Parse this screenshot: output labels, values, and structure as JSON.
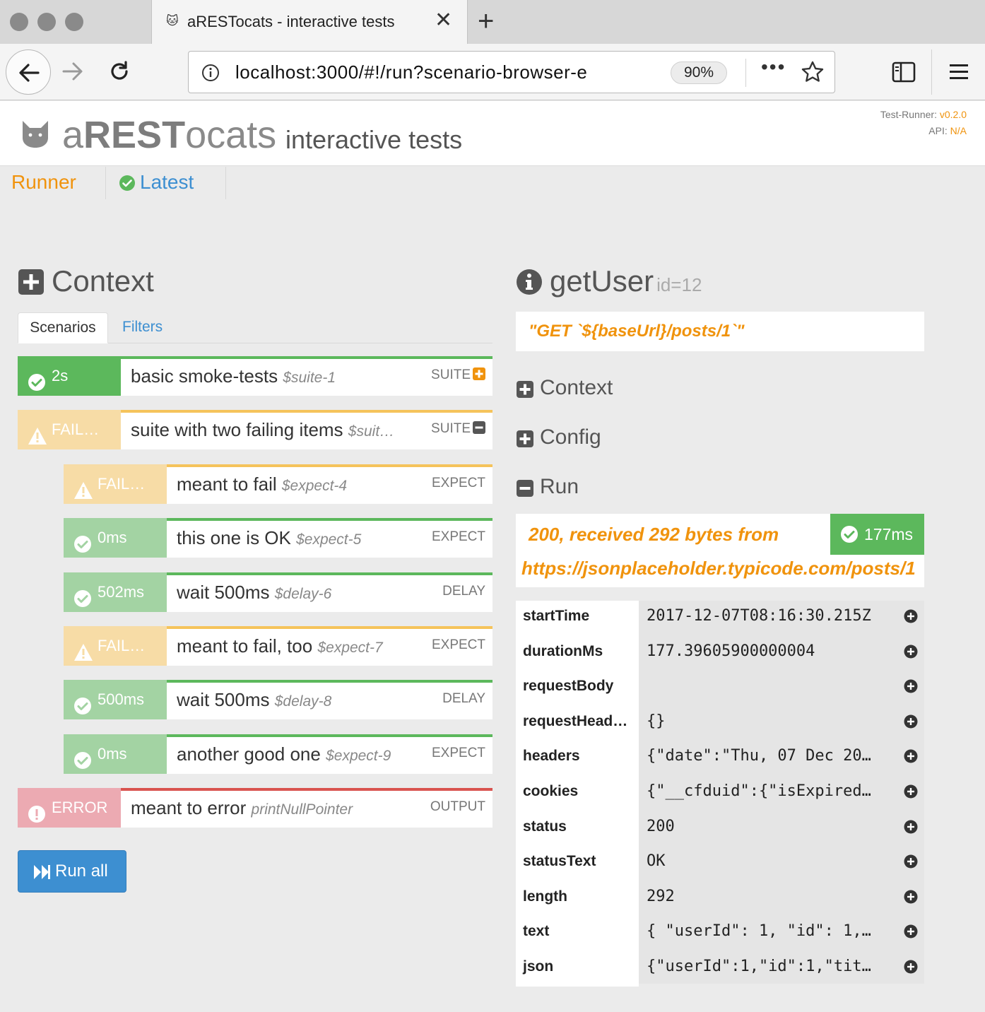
{
  "browser": {
    "tab_title": "aRESTocats - interactive tests",
    "tab_favicon": "🐱",
    "url": "localhost:3000/#!/run?scenario-browser-e",
    "zoom": "90%"
  },
  "header": {
    "brand_regular_1": "a",
    "brand_bold": "REST",
    "brand_regular_2": "ocats",
    "subtitle": "interactive tests",
    "runner_label": "Test-Runner:",
    "runner_version": "v0.2.0",
    "api_label": "API:",
    "api_version": "N/A"
  },
  "menu": {
    "runner": "Runner",
    "latest": "Latest"
  },
  "context": {
    "title": "Context",
    "tabs": {
      "scenarios": "Scenarios",
      "filters": "Filters"
    },
    "scenarios": [
      {
        "status": "ok",
        "badge": "2s",
        "name": "basic smoke-tests",
        "ref": "$suite-1",
        "kind": "SUITE",
        "toggle": "plus",
        "indent": 0
      },
      {
        "status": "fail",
        "badge": "FAIL…",
        "name": "suite with two failing items",
        "ref": "$suit…",
        "kind": "SUITE",
        "toggle": "minus",
        "indent": 0
      },
      {
        "status": "fail",
        "badge": "FAIL…",
        "name": "meant to fail",
        "ref": "$expect-4",
        "kind": "EXPECT",
        "toggle": "",
        "indent": 1
      },
      {
        "status": "ok",
        "badge": "0ms",
        "name": "this one is OK",
        "ref": "$expect-5",
        "kind": "EXPECT",
        "toggle": "",
        "indent": 1
      },
      {
        "status": "ok",
        "badge": "502ms",
        "name": "wait 500ms",
        "ref": "$delay-6",
        "kind": "DELAY",
        "toggle": "",
        "indent": 1
      },
      {
        "status": "fail",
        "badge": "FAIL…",
        "name": "meant to fail, too",
        "ref": "$expect-7",
        "kind": "EXPECT",
        "toggle": "",
        "indent": 1
      },
      {
        "status": "ok",
        "badge": "500ms",
        "name": "wait 500ms",
        "ref": "$delay-8",
        "kind": "DELAY",
        "toggle": "",
        "indent": 1
      },
      {
        "status": "ok",
        "badge": "0ms",
        "name": "another good one",
        "ref": "$expect-9",
        "kind": "EXPECT",
        "toggle": "",
        "indent": 1
      },
      {
        "status": "error",
        "badge": "ERROR",
        "name": "meant to error",
        "ref": "printNullPointer",
        "kind": "OUTPUT",
        "toggle": "",
        "indent": 0
      }
    ],
    "run_all": "Run all"
  },
  "request": {
    "title": "getUser",
    "param": "id=12",
    "url_expr": "\"GET `${baseUrl}/posts/1`\"",
    "sections": {
      "context": "Context",
      "config": "Config",
      "run": "Run"
    },
    "result_line1": "200, received 292 bytes from",
    "result_line2": "https://jsonplaceholder.typicode.com/posts/1",
    "duration": "177ms",
    "fields": [
      {
        "key": "startTime",
        "value": "2017-12-07T08:16:30.215Z"
      },
      {
        "key": "durationMs",
        "value": "177.39605900000004"
      },
      {
        "key": "requestBody",
        "value": ""
      },
      {
        "key": "requestHead…",
        "value": "{}"
      },
      {
        "key": "headers",
        "value": "{\"date\":\"Thu, 07 Dec 20…"
      },
      {
        "key": "cookies",
        "value": "{\"__cfduid\":{\"isExpired…"
      },
      {
        "key": "status",
        "value": "200"
      },
      {
        "key": "statusText",
        "value": "OK"
      },
      {
        "key": "length",
        "value": "292"
      },
      {
        "key": "text",
        "value": "{ \"userId\": 1, \"id\": 1,…"
      },
      {
        "key": "json",
        "value": "{\"userId\":1,\"id\":1,\"tit…"
      }
    ]
  },
  "colors": {
    "accent": "#f0930d",
    "link": "#3d8fd1",
    "ok": "#5cb85c",
    "ok_light": "#a3d3a3",
    "fail_light": "#f7dca6",
    "fail_bar": "#f5c35b",
    "error_light": "#ecaab2",
    "error_bar": "#d9534f"
  }
}
